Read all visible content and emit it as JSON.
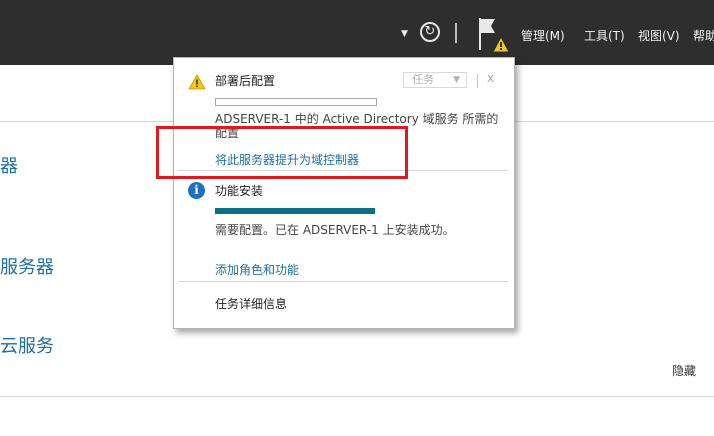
{
  "toolbar": {
    "menu": [
      {
        "label": "管理(M)"
      },
      {
        "label": "工具(T)"
      },
      {
        "label": "视图(V)"
      },
      {
        "label": "帮助"
      }
    ]
  },
  "sidebar": {
    "items": [
      {
        "label": "器"
      },
      {
        "label": "服务器"
      },
      {
        "label": "云服务"
      }
    ]
  },
  "main": {
    "hide_label": "隐藏"
  },
  "notification": {
    "task_dropdown": "任务",
    "close": "x",
    "post_deploy": {
      "title": "部署后配置",
      "message": "ADSERVER-1 中的 Active Directory 域服务 所需的配置",
      "link": "将此服务器提升为域控制器",
      "progress": 0
    },
    "feature_install": {
      "title": "功能安装",
      "message": "需要配置。已在 ADSERVER-1 上安装成功。",
      "link": "添加角色和功能",
      "progress": 1.0
    },
    "task_details": "任务详细信息"
  },
  "colors": {
    "accent": "#1d6fa5",
    "progress": "#0f6e87",
    "highlight": "#e0191f",
    "topbar": "#2e2e2e"
  }
}
